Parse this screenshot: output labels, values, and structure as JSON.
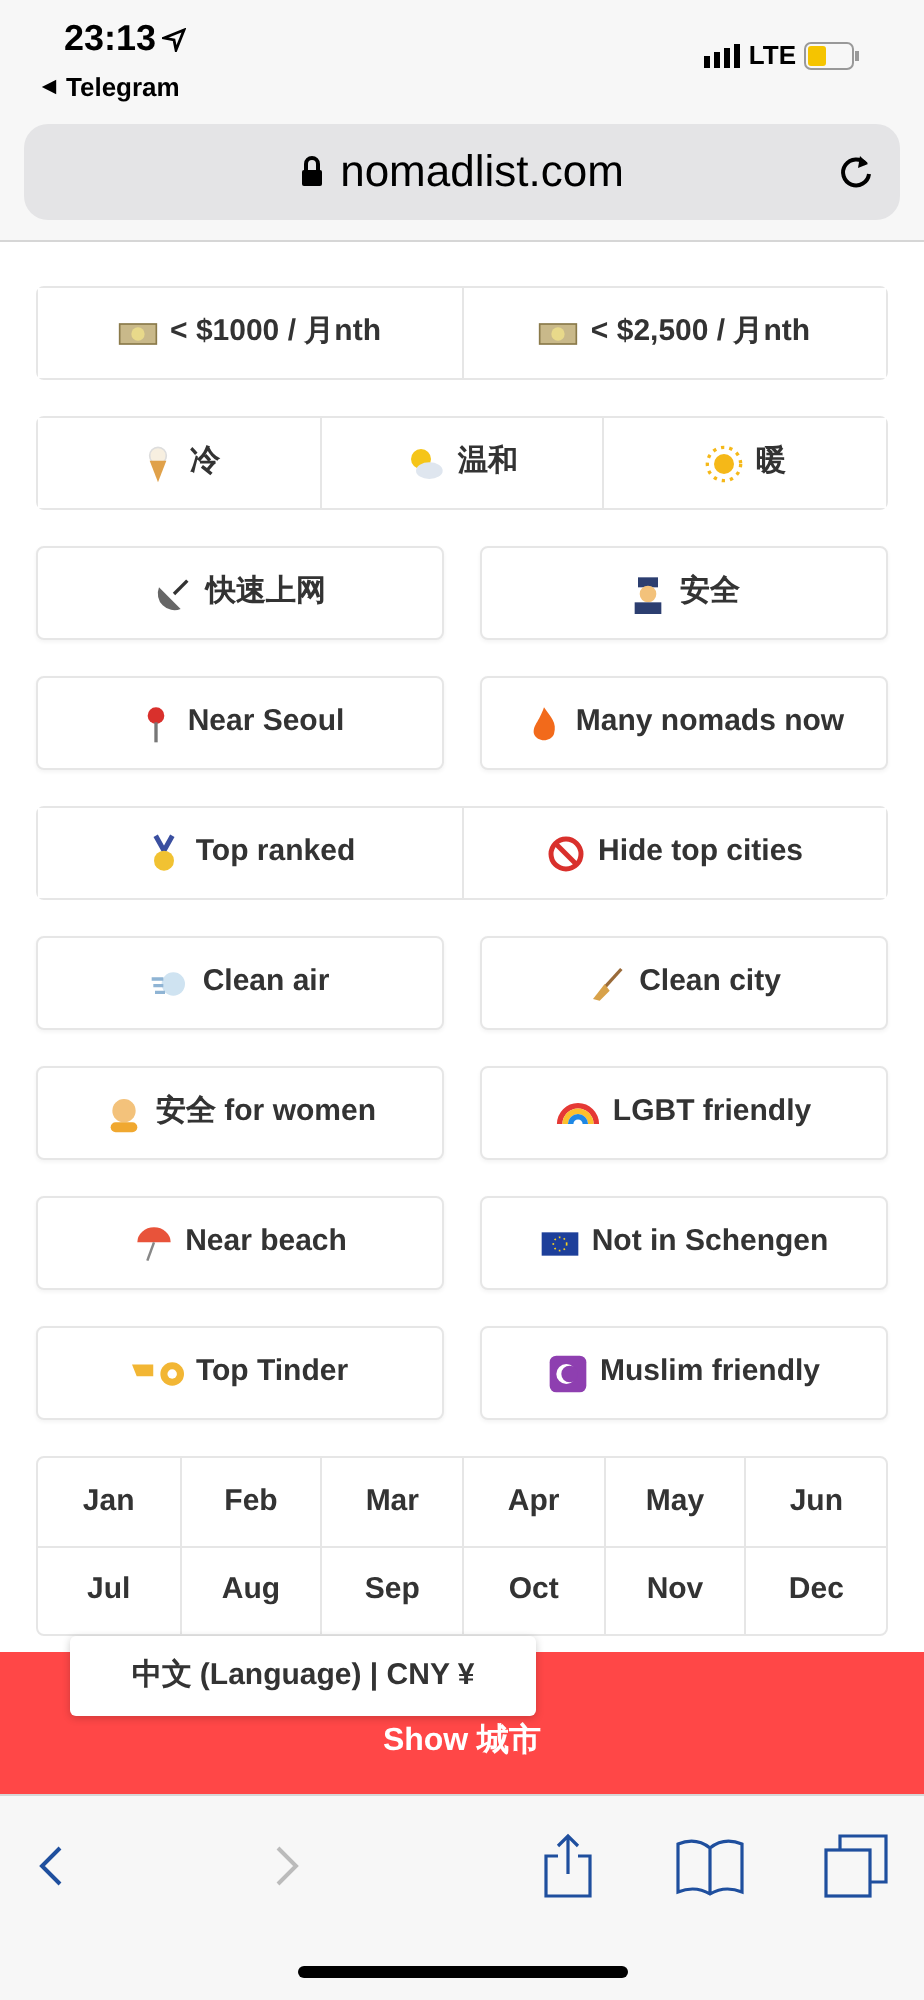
{
  "status_bar": {
    "time": "23:13",
    "back_app": "Telegram",
    "network": "LTE"
  },
  "address_bar": {
    "url": "nomadlist.com"
  },
  "filter_rows": [
    {
      "kind": "joined",
      "buttons": [
        "< $1000 / 月nth",
        "< $2,500 / 月nth"
      ]
    },
    {
      "kind": "joined",
      "buttons": [
        "冷",
        "温和",
        "暖"
      ]
    },
    {
      "kind": "split",
      "buttons": [
        "快速上网",
        "安全"
      ]
    },
    {
      "kind": "split",
      "buttons": [
        "Near Seoul",
        "Many nomads now"
      ]
    },
    {
      "kind": "joined",
      "buttons": [
        "Top ranked",
        "Hide top cities"
      ]
    },
    {
      "kind": "split",
      "buttons": [
        "Clean air",
        "Clean city"
      ]
    },
    {
      "kind": "split",
      "buttons": [
        "安全 for women",
        "LGBT friendly"
      ]
    },
    {
      "kind": "split",
      "buttons": [
        "Near beach",
        "Not in Schengen"
      ]
    },
    {
      "kind": "split",
      "buttons": [
        "Top Tinder",
        "Muslim friendly"
      ]
    }
  ],
  "months": [
    "Jan",
    "Feb",
    "Mar",
    "Apr",
    "May",
    "Jun",
    "Jul",
    "Aug",
    "Sep",
    "Oct",
    "Nov",
    "Dec"
  ],
  "show_button": "Show 城市",
  "language_popup": "中文 (Language) | CNY ¥"
}
